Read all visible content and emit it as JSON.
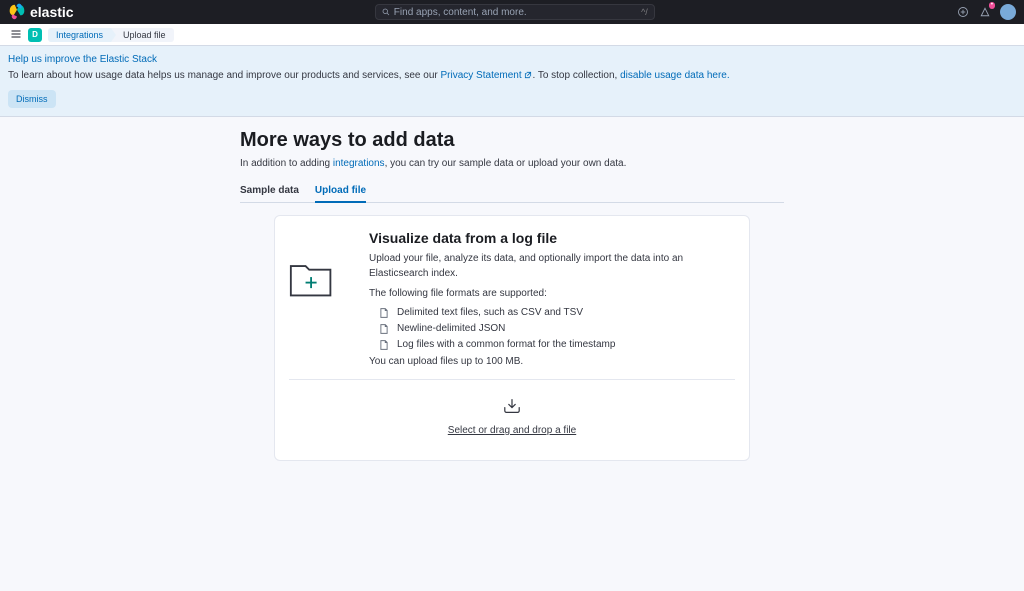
{
  "topbar": {
    "brand": "elastic",
    "search_placeholder": "Find apps, content, and more.",
    "search_shortcut": "^/"
  },
  "navbar": {
    "home_letter": "D",
    "crumbs": [
      "Integrations",
      "Upload file"
    ]
  },
  "banner": {
    "title": "Help us improve the Elastic Stack",
    "text_before": "To learn about how usage data helps us manage and improve our products and services, see our ",
    "privacy_link": "Privacy Statement",
    "text_mid": ". To stop collection, ",
    "disable_link": "disable usage data here.",
    "dismiss": "Dismiss"
  },
  "page": {
    "title": "More ways to add data",
    "sub_before": "In addition to adding ",
    "sub_link": "integrations",
    "sub_after": ", you can try our sample data or upload your own data."
  },
  "tabs": [
    {
      "label": "Sample data",
      "active": false
    },
    {
      "label": "Upload file",
      "active": true
    }
  ],
  "card": {
    "title": "Visualize data from a log file",
    "desc": "Upload your file, analyze its data, and optionally import the data into an Elasticsearch index.",
    "formats_intro": "The following file formats are supported:",
    "formats": [
      "Delimited text files, such as CSV and TSV",
      "Newline-delimited JSON",
      "Log files with a common format for the timestamp"
    ],
    "note": "You can upload files up to 100 MB.",
    "dropzone": "Select or drag and drop a file"
  }
}
